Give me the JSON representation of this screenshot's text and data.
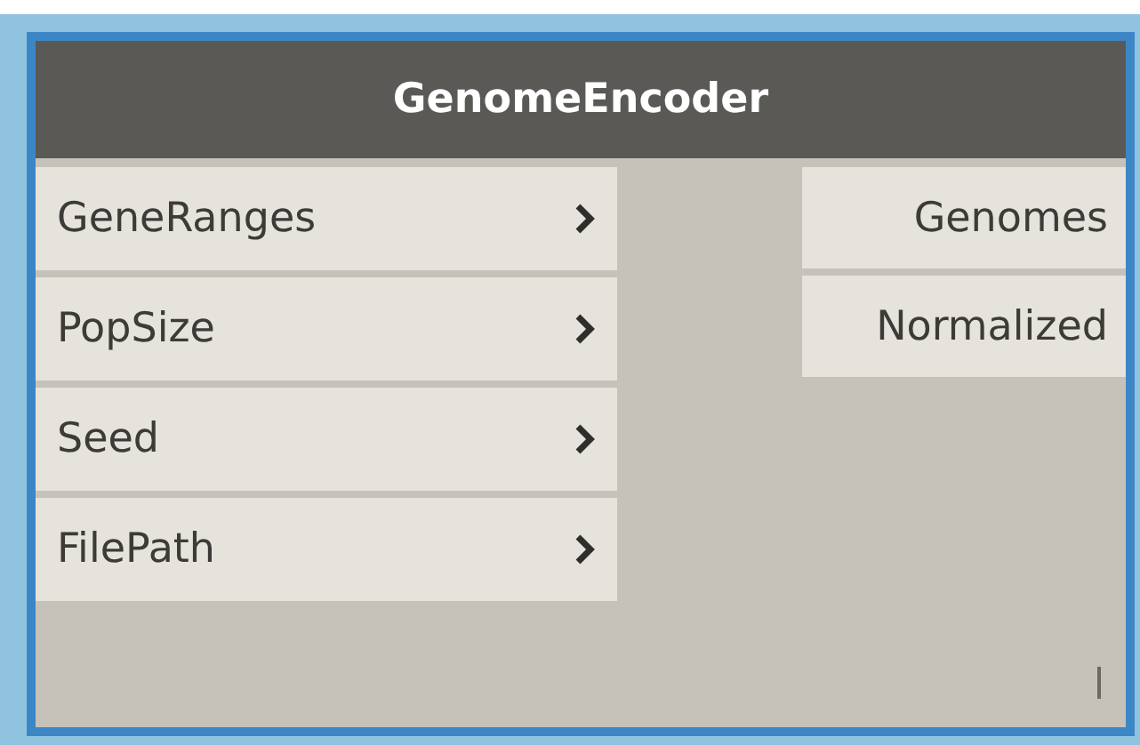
{
  "node": {
    "title": "GenomeEncoder",
    "selected": true,
    "inputs": [
      {
        "label": "GeneRanges"
      },
      {
        "label": "PopSize"
      },
      {
        "label": "Seed"
      },
      {
        "label": "FilePath"
      }
    ],
    "outputs": [
      {
        "label": "Genomes"
      },
      {
        "label": "Normalized"
      }
    ]
  }
}
